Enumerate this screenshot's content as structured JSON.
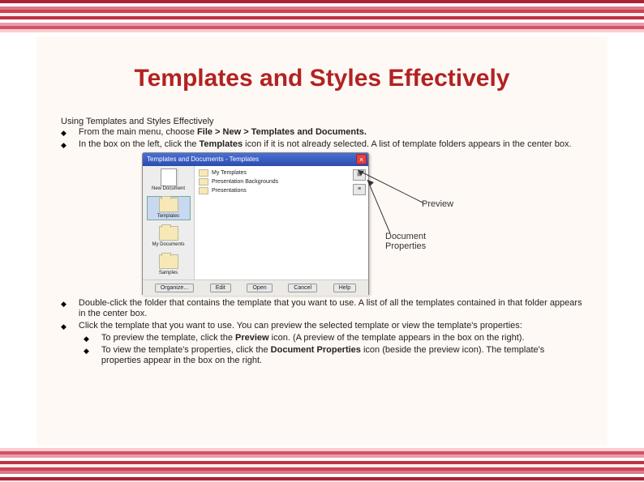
{
  "title": "Templates and Styles Effectively",
  "section_heading": "Using Templates and Styles Effectively",
  "bullets_top": [
    {
      "pre": "From the main menu, choose ",
      "b": "File > New > Templates and Documents.",
      "post": ""
    },
    {
      "pre": "In the box on the left, click the ",
      "b": "Templates",
      "post": " icon if it is not already selected. A list of template folders appears in the center box."
    }
  ],
  "bullets_bottom": [
    {
      "pre": "Double-click the folder that contains the template that you want to use. A list of all the templates contained in that folder appears in the center box.",
      "b": "",
      "post": ""
    },
    {
      "pre": "Click the template that you want to use. You can preview the selected template or view the template's properties:",
      "b": "",
      "post": ""
    }
  ],
  "sub_bullets": [
    {
      "pre": "To preview the template, click the ",
      "b": "Preview",
      "post": " icon. (A preview of the template appears in the box on the right)."
    },
    {
      "pre": "To view the template's properties, click the ",
      "b": "Document Properties",
      "post": " icon (beside the preview icon). The template's properties appear in the box on the right."
    }
  ],
  "dialog": {
    "title": "Templates and Documents - Templates",
    "close": "×",
    "left_items": [
      "New Document",
      "Templates",
      "My Documents",
      "Samples"
    ],
    "center_items": [
      "My Templates",
      "Presentation Backgrounds",
      "Presentations"
    ],
    "buttons": [
      "Organize...",
      "Edit",
      "Open",
      "Cancel",
      "Help"
    ],
    "right_icons": [
      "⊞",
      "≡"
    ]
  },
  "annotations": {
    "preview": "Preview",
    "docprops": "Document Properties"
  },
  "stripe_colors_top": [
    "#aa2233",
    "#ffffff",
    "#dd7788",
    "#cc4455",
    "#ffeeee",
    "#bb3344",
    "#ffffff",
    "#ee99aa",
    "#cc5566",
    "#ffcccc"
  ],
  "stripe_colors_bottom": [
    "#ffcccc",
    "#cc5566",
    "#ee99aa",
    "#ffffff",
    "#bb3344",
    "#ffeeee",
    "#cc4455",
    "#dd7788",
    "#ffffff",
    "#aa2233"
  ]
}
